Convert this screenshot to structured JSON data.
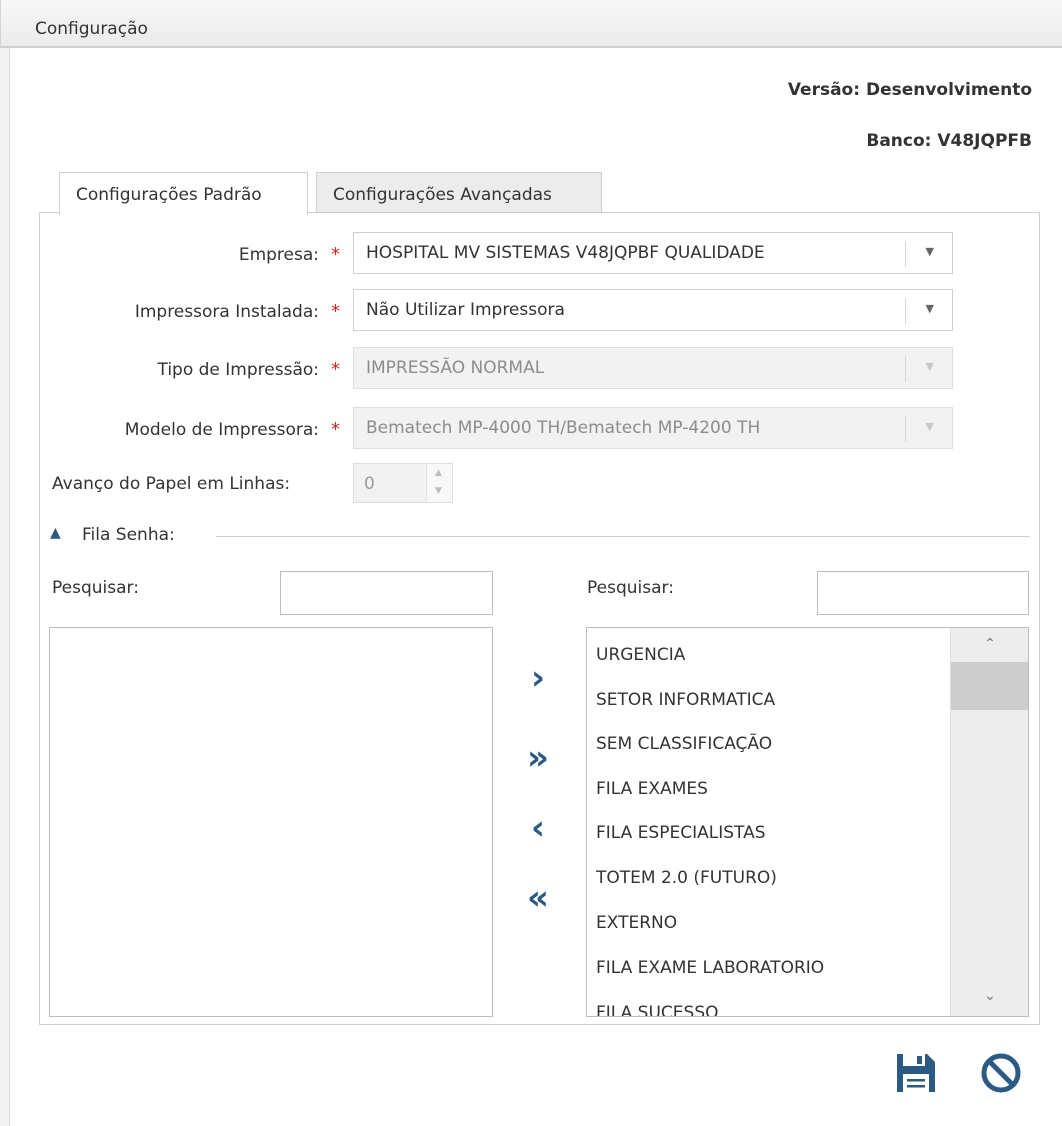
{
  "window": {
    "title": "Configuração"
  },
  "header": {
    "version": "Versão: Desenvolvimento",
    "bank": "Banco: V48JQPFB"
  },
  "tabs": [
    {
      "label": "Configurações Padrão",
      "active": true
    },
    {
      "label": "Configurações Avançadas",
      "active": false
    }
  ],
  "form": {
    "empresa_label": "Empresa:",
    "empresa_value": "HOSPITAL MV SISTEMAS V48JQPBF QUALIDADE",
    "impressora_label": "Impressora Instalada:",
    "impressora_value": "Não Utilizar Impressora",
    "tipo_label": "Tipo de Impressão:",
    "tipo_value": "IMPRESSÃO NORMAL",
    "modelo_label": "Modelo de Impressora:",
    "modelo_value": "Bematech MP-4000 TH/Bematech MP-4200 TH",
    "avanco_label": "Avanço do Papel em Linhas:",
    "avanco_value": "0",
    "required_mark": "*"
  },
  "fila": {
    "group_label": "Fila Senha:",
    "left_search_label": "Pesquisar:",
    "right_search_label": "Pesquisar:",
    "left_items": [],
    "right_items": [
      "URGENCIA",
      "SETOR INFORMATICA",
      "SEM CLASSIFICAÇÃO",
      "FILA EXAMES",
      "FILA ESPECIALISTAS",
      "TOTEM 2.0 (FUTURO)",
      "EXTERNO",
      "FILA EXAME LABORATORIO",
      "FILA SUCESSO"
    ]
  },
  "transfer": {
    "move_one": "›",
    "move_all": "»",
    "back_one": "‹",
    "back_all": "«"
  },
  "icons": {
    "save": "save-icon",
    "cancel": "cancel-icon",
    "accent_color": "#2b5a83",
    "required_color": "#e02020"
  }
}
